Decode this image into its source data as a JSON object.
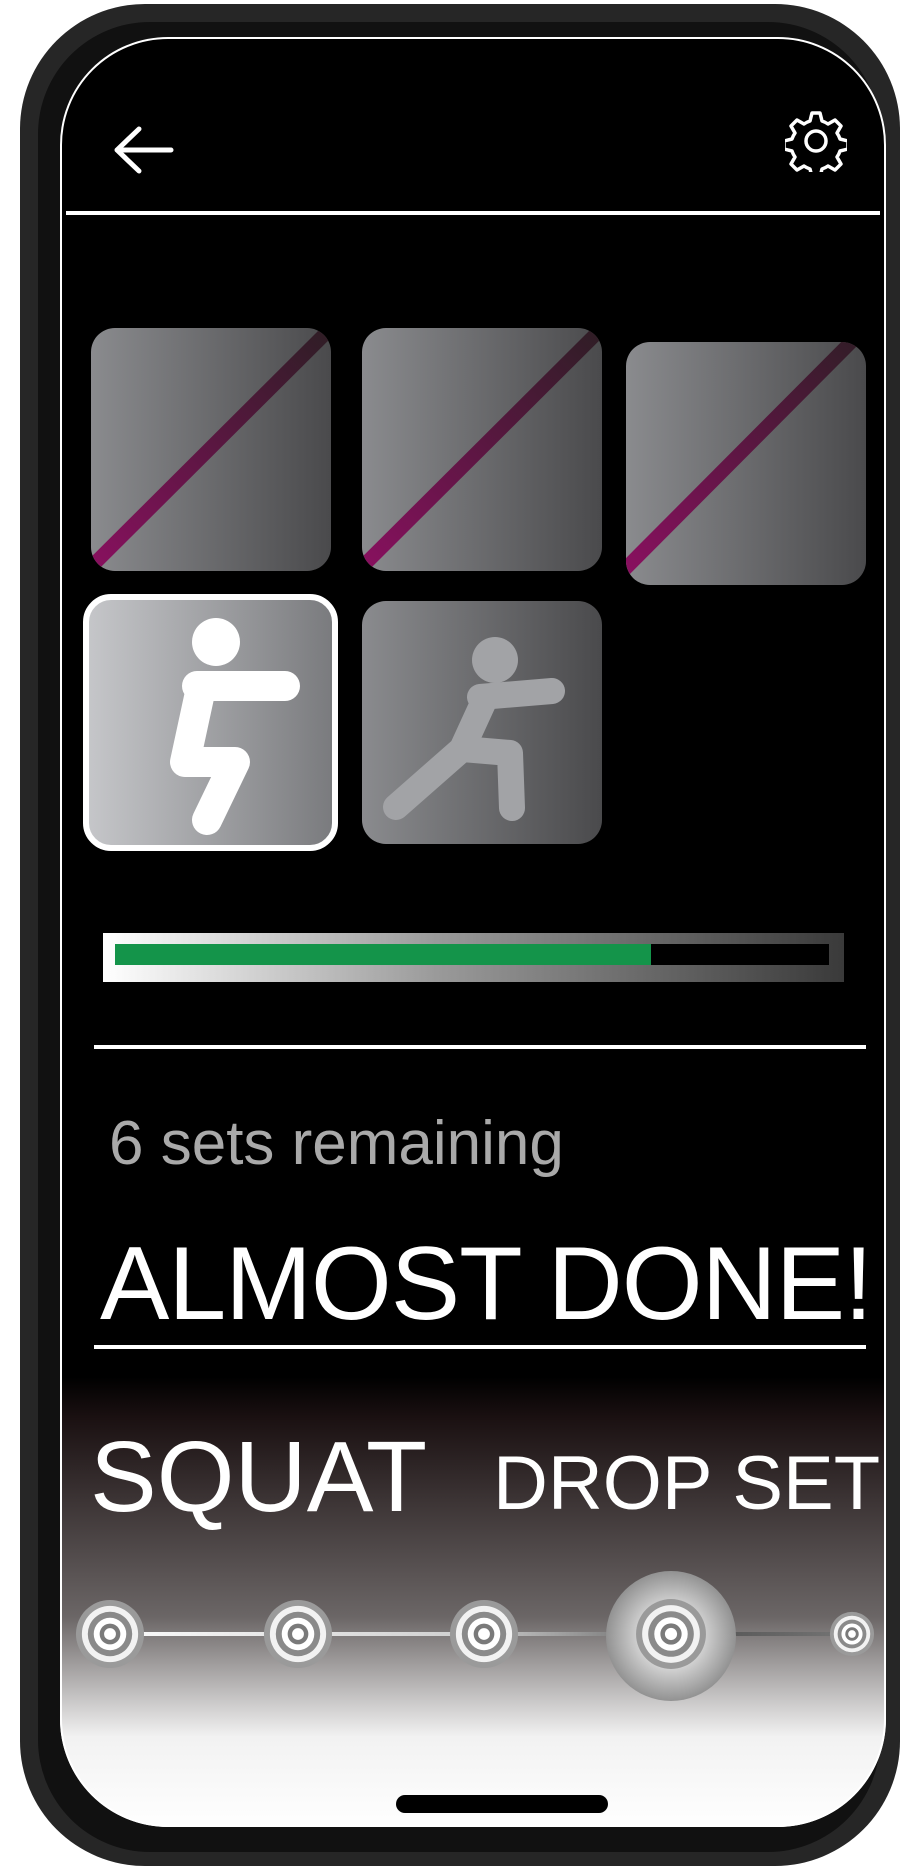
{
  "colors": {
    "background": "#000000",
    "progress_fill": "#14944a",
    "completed_strike": "#8a1a5a",
    "text_primary": "#ffffff",
    "text_secondary": "#a9a9a9"
  },
  "header": {
    "back_icon": "back-arrow-icon",
    "settings_icon": "gear-icon"
  },
  "exercise_tiles": [
    {
      "state": "completed",
      "icon": "blank-tile"
    },
    {
      "state": "completed",
      "icon": "blank-tile"
    },
    {
      "state": "completed",
      "icon": "blank-tile"
    },
    {
      "state": "current",
      "icon": "squat-figure-icon"
    },
    {
      "state": "upcoming",
      "icon": "lunge-figure-icon"
    }
  ],
  "progress": {
    "fraction": 0.75
  },
  "status": {
    "sets_remaining": "6 sets remaining",
    "headline": "ALMOST DONE!"
  },
  "exercise": {
    "name": "SQUAT",
    "mode": "DROP SET"
  },
  "set_steps": {
    "total": 5,
    "current_index": 3
  }
}
